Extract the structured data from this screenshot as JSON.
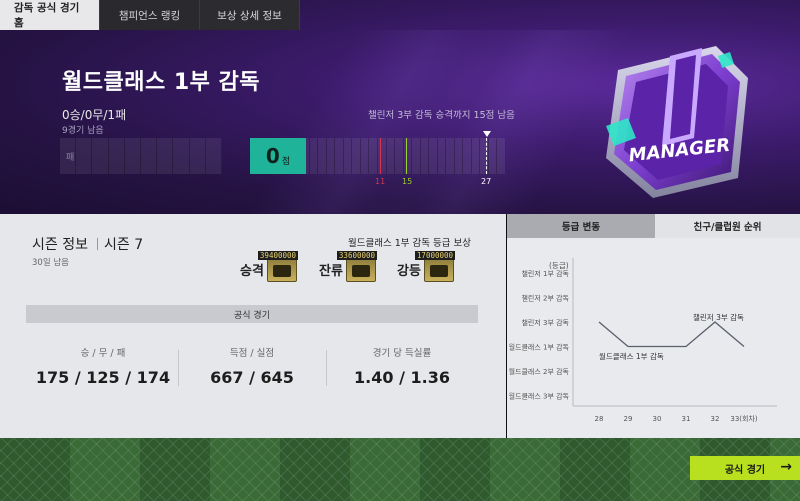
{
  "tabs": [
    {
      "label": "감독 공식 경기 홈",
      "active": true
    },
    {
      "label": "챔피언스 랭킹",
      "active": false
    },
    {
      "label": "보상 상세 정보",
      "active": false
    }
  ],
  "hero": {
    "title": "월드클래스 1부 감독",
    "record": "0승/0무/1패",
    "games_left": "9경기 남음",
    "promotion_note": "챌린저 3부 감독 승격까지 15점 남음",
    "bar_left_label": "패",
    "score": "0",
    "score_unit": "점",
    "markers": [
      {
        "label": "11",
        "color": "#d8344e"
      },
      {
        "label": "15",
        "color": "#9bcf2a"
      },
      {
        "label": "27",
        "color": "#ffffff"
      }
    ],
    "badge_text": "MANAGER",
    "badge_number": "1"
  },
  "season": {
    "label": "시즌 정보",
    "value": "시즌 7",
    "days_left": "30일 남음",
    "reward_title": "월드클래스 1부 감독 등급 보상",
    "rewards": [
      {
        "name": "승격",
        "amount": "39400000"
      },
      {
        "name": "잔류",
        "amount": "33600000"
      },
      {
        "name": "강등",
        "amount": "17000000"
      }
    ]
  },
  "official": {
    "section_label": "공식 경기",
    "stats": [
      {
        "key": "승 / 무 / 패",
        "value": "175 / 125 / 174"
      },
      {
        "key": "득점 / 실점",
        "value": "667 / 645"
      },
      {
        "key": "경기 당 득실률",
        "value": "1.40 / 1.36"
      }
    ]
  },
  "graph": {
    "tabs": [
      {
        "label": "등급 변동",
        "active": true
      },
      {
        "label": "친구/클럽원 순위",
        "active": false
      }
    ],
    "y_unit": "(등급)",
    "annotations": [
      "챌린저 3부 감독",
      "월드클래스 1부 감독"
    ]
  },
  "chart_data": {
    "type": "line",
    "title": "",
    "xlabel": "(회차)",
    "ylabel": "(등급)",
    "categories": [
      "챌린저 1부 감독",
      "챌린저 2부 감독",
      "챌린저 3부 감독",
      "월드클래스 1부 감독",
      "월드클래스 2부 감독",
      "월드클래스 3부 감독"
    ],
    "x": [
      28,
      29,
      30,
      31,
      32,
      33
    ],
    "x_tick_labels": [
      "28",
      "29",
      "30",
      "31",
      "32",
      "33(회차)"
    ],
    "values": [
      "챌린저 3부 감독",
      "월드클래스 1부 감독",
      "월드클래스 1부 감독",
      "월드클래스 1부 감독",
      "챌린저 3부 감독",
      "월드클래스 1부 감독"
    ]
  },
  "footer": {
    "play_button": "공식 경기",
    "arrow": "→"
  },
  "colors": {
    "accent_green": "#1fb39a",
    "play_button": "#b8e01e",
    "hero_purple": "#3b1b6b"
  }
}
